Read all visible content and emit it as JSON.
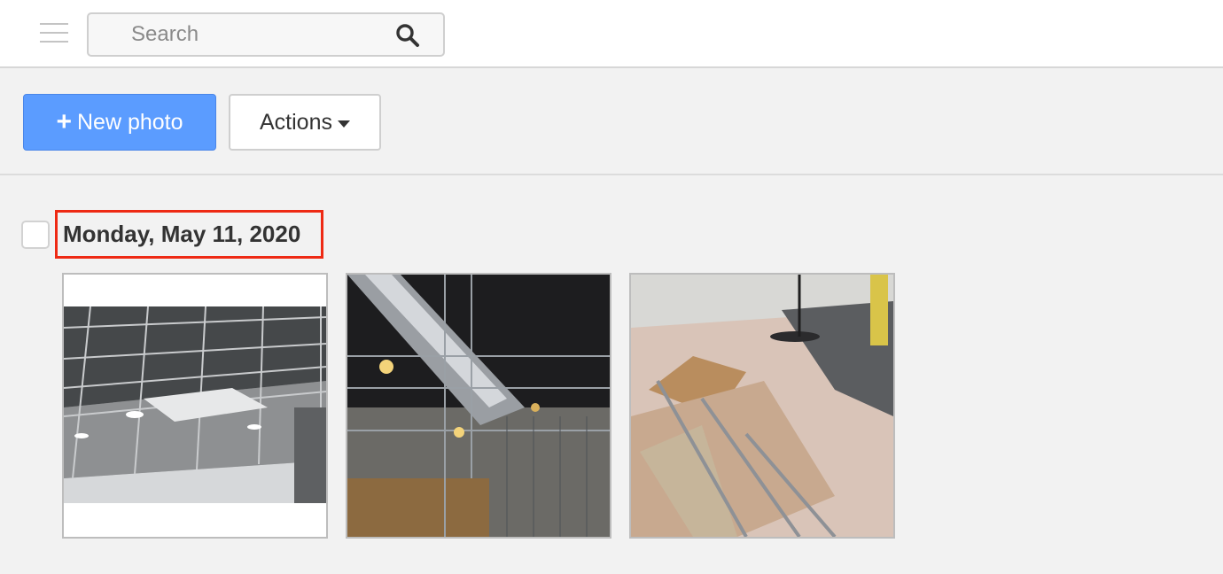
{
  "header": {
    "menu_icon": "hamburger-menu-icon",
    "search": {
      "placeholder": "Search",
      "value": "",
      "icon": "search-icon"
    }
  },
  "toolbar": {
    "new_photo_label": "New photo",
    "new_photo_icon": "plus-icon",
    "actions_label": "Actions",
    "actions_icon": "caret-down-icon"
  },
  "colors": {
    "accent": "#5b9cff",
    "highlight": "#ee2a14",
    "background": "#f2f2f2"
  },
  "group": {
    "date": "Monday, May 11, 2020",
    "checked": false,
    "photos": [
      {
        "subject": "ceiling-grid-photo"
      },
      {
        "subject": "ductwork-photo"
      },
      {
        "subject": "floor-materials-photo"
      }
    ]
  }
}
